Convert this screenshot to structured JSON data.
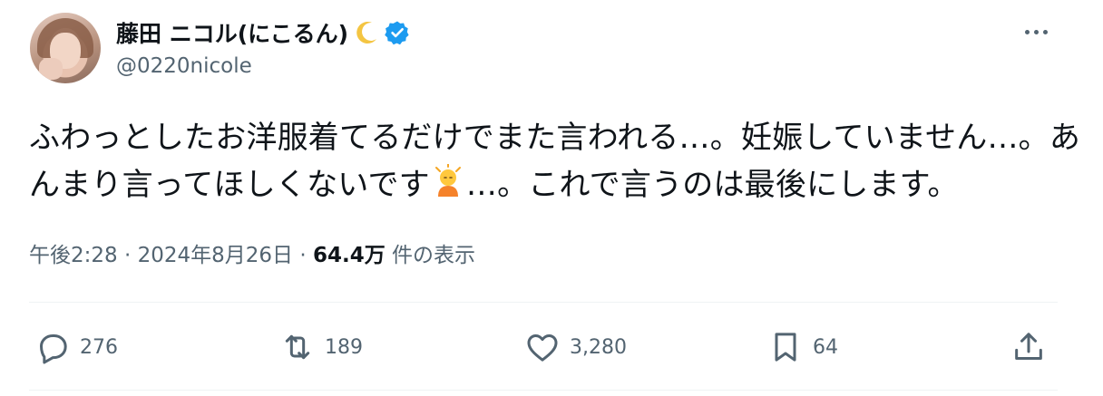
{
  "user": {
    "display_name": "藤田 ニコル(にこるん)",
    "handle": "@0220nicole",
    "verified": true
  },
  "tweet": {
    "text_part1": "ふわっとしたお洋服着てるだけでまた言われる…。妊娠していません…。あんまり言ってほしくないです",
    "text_part2": "…。これで言うのは最後にします。",
    "time": "午後2:28",
    "separator": "·",
    "date": "2024年8月26日",
    "views": "64.4万",
    "views_label": "件の表示"
  },
  "actions": {
    "replies": "276",
    "retweets": "189",
    "likes": "3,280",
    "bookmarks": "64"
  },
  "colors": {
    "secondary_text": "#536471",
    "verified_blue": "#1d9bf0",
    "divider": "#eff3f4"
  },
  "icons": [
    "moon-emoji-icon",
    "verified-badge-icon",
    "more-options-icon",
    "person-gesturing-emoji-icon",
    "reply-icon",
    "retweet-icon",
    "like-icon",
    "bookmark-icon",
    "share-icon"
  ]
}
